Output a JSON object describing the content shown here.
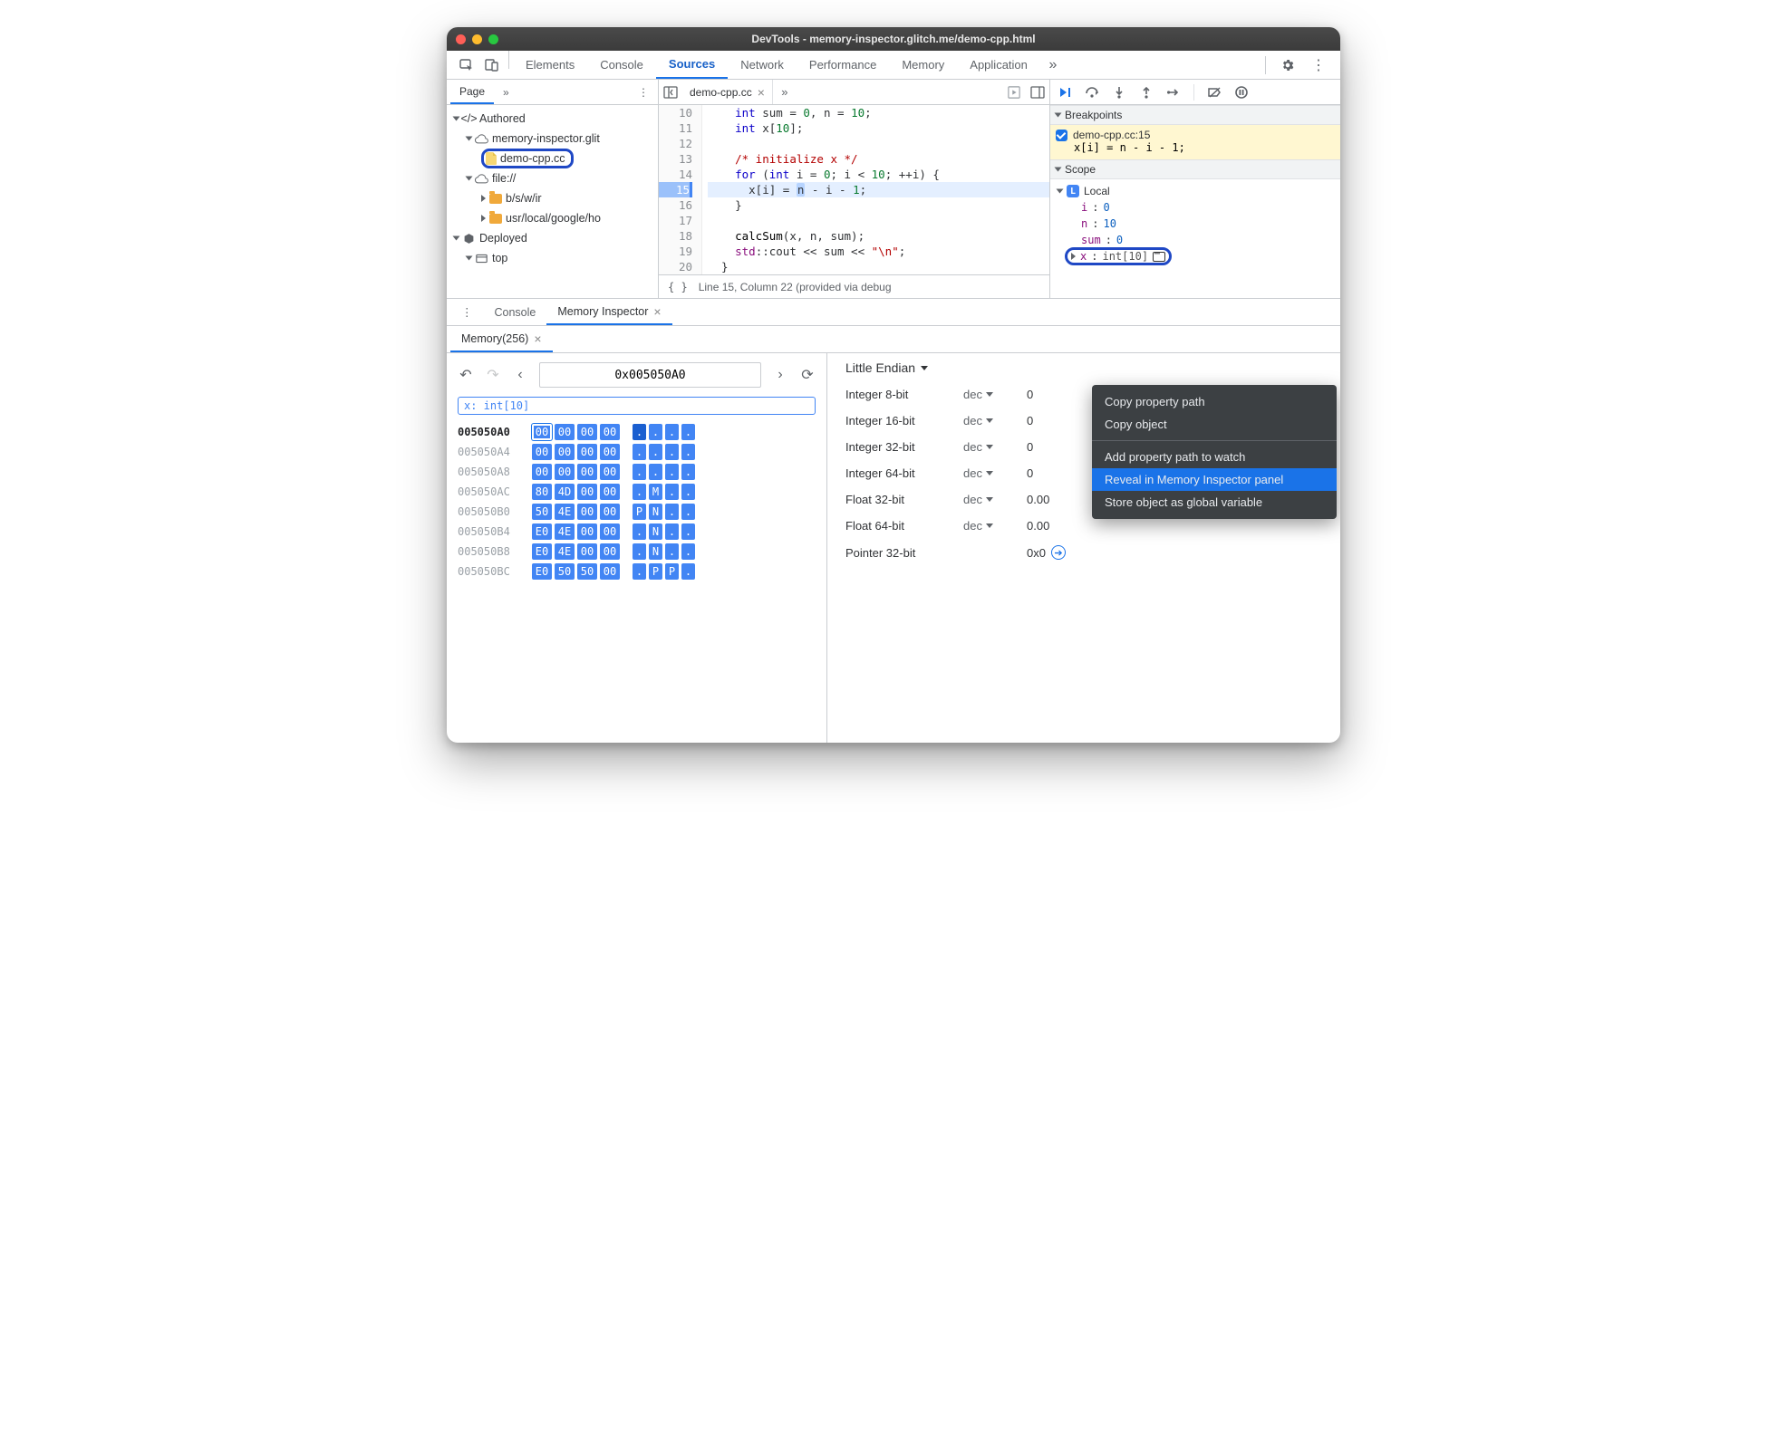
{
  "window_title": "DevTools - memory-inspector.glitch.me/demo-cpp.html",
  "main_tabs": [
    "Elements",
    "Console",
    "Sources",
    "Network",
    "Performance",
    "Memory",
    "Application"
  ],
  "main_active": "Sources",
  "nav_tab": "Page",
  "tree": {
    "authored": "Authored",
    "domain": "memory-inspector.glit",
    "file": "demo-cpp.cc",
    "file_proto": "file://",
    "folder1": "b/s/w/ir",
    "folder2": "usr/local/google/ho",
    "deployed": "Deployed",
    "top": "top"
  },
  "editor": {
    "tab": "demo-cpp.cc",
    "lines": {
      "10": "    int sum = 0, n = 10;",
      "11": "    int x[10];",
      "12": "",
      "13": "    /* initialize x */",
      "14": "    for (int i = 0; i < 10; ++i) {",
      "15": "      x[i] = n - i - 1;",
      "16": "    }",
      "17": "",
      "18": "    calcSum(x, n, sum);",
      "19": "    std::cout << sum << \"\\n\";",
      "20": "  }"
    },
    "status": "Line 15, Column 22 (provided via debug"
  },
  "debug": {
    "breakpoints_title": "Breakpoints",
    "bp_file": "demo-cpp.cc:15",
    "bp_code": "x[i] = n - i - 1;",
    "scope_title": "Scope",
    "local_label": "Local",
    "vars": {
      "i": {
        "name": "i",
        "val": "0"
      },
      "n": {
        "name": "n",
        "val": "10"
      },
      "sum": {
        "name": "sum",
        "val": "0"
      },
      "x": {
        "name": "x",
        "val": "int[10]"
      }
    }
  },
  "context_menu": {
    "copy_path": "Copy property path",
    "copy_obj": "Copy object",
    "add_watch": "Add property path to watch",
    "reveal": "Reveal in Memory Inspector panel",
    "store": "Store object as global variable"
  },
  "drawer": {
    "console": "Console",
    "inspector": "Memory Inspector",
    "mem_tab": "Memory(256)"
  },
  "mem": {
    "address": "0x005050A0",
    "badge": "x: int[10]",
    "rows": [
      {
        "addr": "005050A0",
        "bytes": [
          "00",
          "00",
          "00",
          "00"
        ],
        "ascii": [
          ".",
          ".",
          ".",
          "."
        ],
        "current": true
      },
      {
        "addr": "005050A4",
        "bytes": [
          "00",
          "00",
          "00",
          "00"
        ],
        "ascii": [
          ".",
          ".",
          ".",
          "."
        ]
      },
      {
        "addr": "005050A8",
        "bytes": [
          "00",
          "00",
          "00",
          "00"
        ],
        "ascii": [
          ".",
          ".",
          ".",
          "."
        ]
      },
      {
        "addr": "005050AC",
        "bytes": [
          "80",
          "4D",
          "00",
          "00"
        ],
        "ascii": [
          ".",
          "M",
          ".",
          "."
        ]
      },
      {
        "addr": "005050B0",
        "bytes": [
          "50",
          "4E",
          "00",
          "00"
        ],
        "ascii": [
          "P",
          "N",
          ".",
          "."
        ]
      },
      {
        "addr": "005050B4",
        "bytes": [
          "E0",
          "4E",
          "00",
          "00"
        ],
        "ascii": [
          ".",
          "N",
          ".",
          "."
        ]
      },
      {
        "addr": "005050B8",
        "bytes": [
          "E0",
          "4E",
          "00",
          "00"
        ],
        "ascii": [
          ".",
          "N",
          ".",
          "."
        ]
      },
      {
        "addr": "005050BC",
        "bytes": [
          "E0",
          "50",
          "50",
          "00"
        ],
        "ascii": [
          ".",
          "P",
          "P",
          "."
        ]
      }
    ],
    "endian": "Little Endian",
    "values": [
      {
        "label": "Integer 8-bit",
        "fmt": "dec",
        "val": "0"
      },
      {
        "label": "Integer 16-bit",
        "fmt": "dec",
        "val": "0"
      },
      {
        "label": "Integer 32-bit",
        "fmt": "dec",
        "val": "0"
      },
      {
        "label": "Integer 64-bit",
        "fmt": "dec",
        "val": "0"
      },
      {
        "label": "Float 32-bit",
        "fmt": "dec",
        "val": "0.00"
      },
      {
        "label": "Float 64-bit",
        "fmt": "dec",
        "val": "0.00"
      },
      {
        "label": "Pointer 32-bit",
        "fmt": "",
        "val": "0x0",
        "link": true
      }
    ]
  }
}
